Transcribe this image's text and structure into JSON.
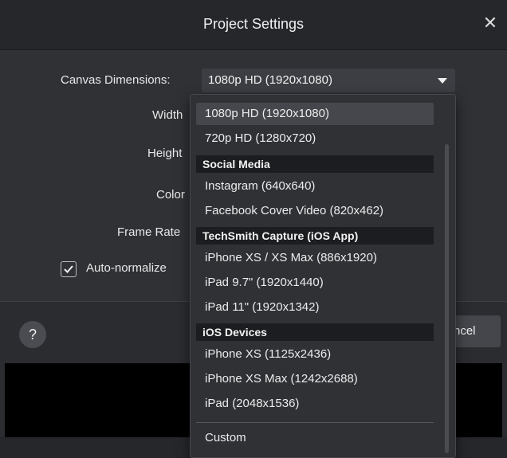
{
  "dialog": {
    "title": "Project Settings",
    "close_glyph": "✕"
  },
  "form": {
    "canvas_label": "Canvas Dimensions:",
    "canvas_value": "1080p HD (1920x1080)",
    "width_label": "Width",
    "height_label": "Height",
    "color_label": "Color",
    "frame_rate_label": "Frame Rate",
    "auto_normalize_label": "Auto-normalize",
    "auto_normalize_checked": true
  },
  "footer": {
    "help_label": "?",
    "cancel_partial_label": "ncel"
  },
  "dropdown": {
    "items": [
      {
        "type": "option",
        "label": "1080p HD (1920x1080)",
        "selected": true
      },
      {
        "type": "option",
        "label": "720p HD (1280x720)"
      },
      {
        "type": "header",
        "label": "Social Media"
      },
      {
        "type": "option",
        "label": "Instagram (640x640)"
      },
      {
        "type": "option",
        "label": "Facebook Cover Video (820x462)"
      },
      {
        "type": "header",
        "label": "TechSmith Capture (iOS App)"
      },
      {
        "type": "option",
        "label": "iPhone XS / XS Max (886x1920)"
      },
      {
        "type": "option",
        "label": "iPad 9.7\" (1920x1440)"
      },
      {
        "type": "option",
        "label": "iPad 11\" (1920x1342)"
      },
      {
        "type": "header",
        "label": "iOS Devices"
      },
      {
        "type": "option",
        "label": "iPhone XS (1125x2436)"
      },
      {
        "type": "option",
        "label": "iPhone XS Max (1242x2688)"
      },
      {
        "type": "option",
        "label": "iPad (2048x1536)"
      },
      {
        "type": "option",
        "label": "Custom"
      }
    ]
  },
  "colors": {
    "background": "#2f3135",
    "selected_option": "#45474c",
    "group_header": "#1c1d20"
  }
}
